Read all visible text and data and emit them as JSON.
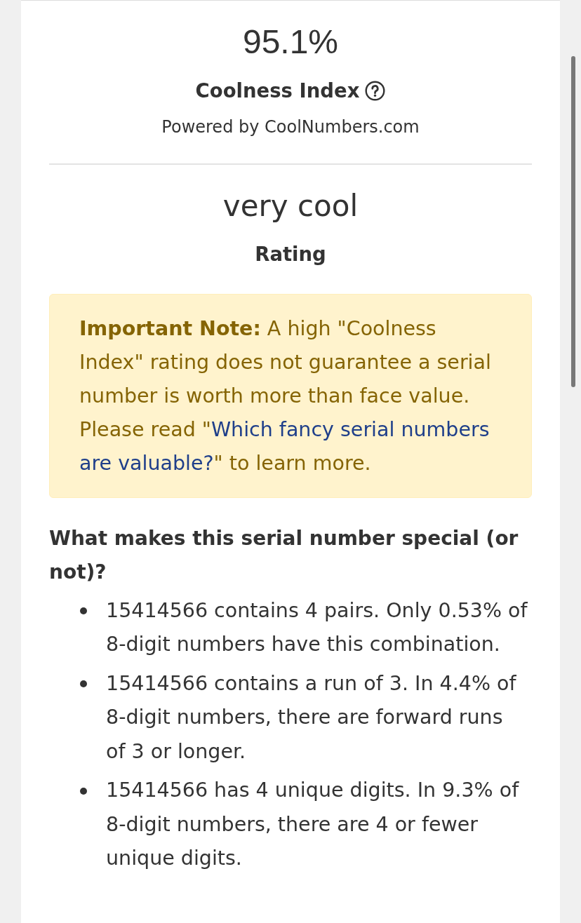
{
  "score": {
    "value": "95.1%",
    "label": "Coolness Index",
    "source": "Powered by CoolNumbers.com"
  },
  "rating": {
    "value": "very cool",
    "label": "Rating"
  },
  "note": {
    "text": "**Important Note:** A high \"Coolness Index\" rating does not guarantee a serial number is worth more than face value. Please read \"",
    "link": [
      "Which fancy serial numbers",
      "are valuable?"
    ],
    "tail": "\" to learn more."
  },
  "details": {
    "heading": "What makes this serial number special (or not)?",
    "items": [
      "15414566 contains 4 pairs. Only 0.53% of 8-digit numbers have this combination.",
      "15414566 contains a run of 3. In 4.4% of 8-digit numbers, there are forward runs of 3 or longer.",
      "15414566 has 4 unique digits. In 9.3% of 8-digit numbers, there are 4 or fewer unique digits."
    ]
  }
}
